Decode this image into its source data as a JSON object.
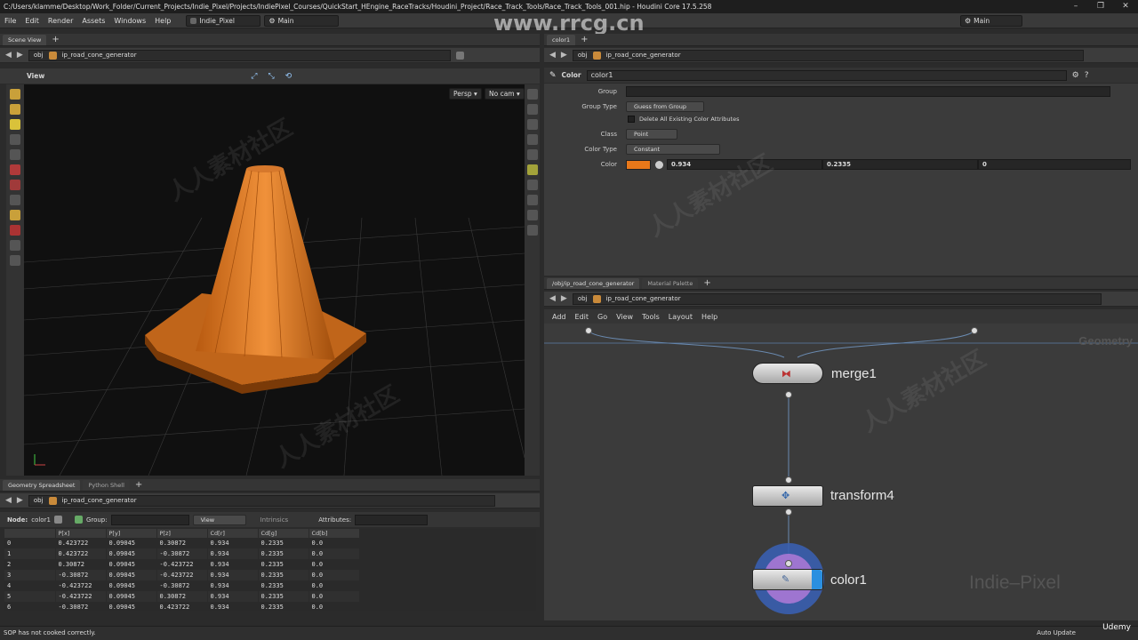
{
  "window": {
    "title": "C:/Users/klamme/Desktop/Work_Folder/Current_Projects/Indie_Pixel/Projects/IndiePixel_Courses/QuickStart_HEngine_RaceTracks/Houdini_Project/Race_Track_Tools/Race_Track_Tools_001.hip - Houdini Core 17.5.258",
    "controls": [
      "–",
      "❐",
      "✕"
    ]
  },
  "menubar": {
    "items": [
      "File",
      "Edit",
      "Render",
      "Assets",
      "Windows",
      "Help"
    ],
    "desktop": "Indie_Pixel",
    "main": "Main",
    "right_main": "Main"
  },
  "watermark_site": "www.rrcg.cn",
  "scene_view": {
    "tab": "Scene View",
    "path_obj": "obj",
    "path_node": "ip_road_cone_generator",
    "view_label": "View",
    "persp": "Persp ▾",
    "nocam": "No cam ▾"
  },
  "params": {
    "tab": "color1",
    "path_obj": "obj",
    "path_node": "ip_road_cone_generator",
    "node_type": "Color",
    "node_name": "color1",
    "group_label": "Group",
    "group_value": "",
    "group_type_label": "Group Type",
    "group_type_value": "Guess from Group",
    "delete_attr_label": "Delete All Existing Color Attributes",
    "class_label": "Class",
    "class_value": "Point",
    "color_type_label": "Color Type",
    "color_type_value": "Constant",
    "color_label": "Color",
    "color_swatch": "#e8781a",
    "color_r": "0.934",
    "color_g": "0.2335",
    "color_b": "0"
  },
  "network": {
    "tabs": [
      "/obj/ip_road_cone_generator",
      "Material Palette"
    ],
    "path_obj": "obj",
    "path_node": "ip_road_cone_generator",
    "menu": [
      "Add",
      "Edit",
      "Go",
      "View",
      "Tools",
      "Layout",
      "Help"
    ],
    "context_label": "Geometry",
    "nodes": [
      {
        "name": "merge1"
      },
      {
        "name": "transform4"
      },
      {
        "name": "color1"
      }
    ],
    "brand": "Indie–Pixel"
  },
  "spreadsheet": {
    "tabs": [
      "Geometry Spreadsheet",
      "Python Shell"
    ],
    "path_obj": "obj",
    "path_node": "ip_road_cone_generator",
    "node_label": "Node:",
    "node_value": "color1",
    "group_label": "Group:",
    "view_label": "View",
    "intrinsics_label": "Intrinsics",
    "attributes_label": "Attributes:",
    "columns": [
      "",
      "P[x]",
      "P[y]",
      "P[z]",
      "Cd[r]",
      "Cd[g]",
      "Cd[b]"
    ],
    "rows": [
      [
        "0",
        "0.423722",
        "0.09045",
        "0.30872",
        "0.934",
        "0.2335",
        "0.0"
      ],
      [
        "1",
        "0.423722",
        "0.09045",
        "-0.30872",
        "0.934",
        "0.2335",
        "0.0"
      ],
      [
        "2",
        "0.30872",
        "0.09045",
        "-0.423722",
        "0.934",
        "0.2335",
        "0.0"
      ],
      [
        "3",
        "-0.30872",
        "0.09045",
        "-0.423722",
        "0.934",
        "0.2335",
        "0.0"
      ],
      [
        "4",
        "-0.423722",
        "0.09045",
        "-0.30872",
        "0.934",
        "0.2335",
        "0.0"
      ],
      [
        "5",
        "-0.423722",
        "0.09045",
        "0.30872",
        "0.934",
        "0.2335",
        "0.0"
      ],
      [
        "6",
        "-0.30872",
        "0.09045",
        "0.423722",
        "0.934",
        "0.2335",
        "0.0"
      ]
    ]
  },
  "status": {
    "message": "SOP has not cooked correctly.",
    "right": "Auto Update",
    "udemy": "Udemy"
  },
  "colors": {
    "cone": "#e07a22",
    "selection": "#2a8fe0",
    "background": "#2b2b2b"
  }
}
